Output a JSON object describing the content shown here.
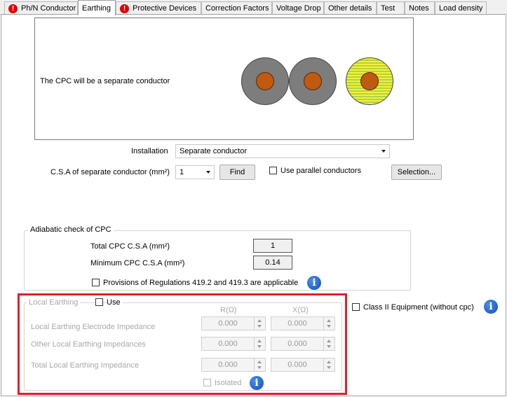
{
  "tabs": [
    {
      "label": "Ph/N Conductor",
      "warning": true
    },
    {
      "label": "Earthing",
      "active": true
    },
    {
      "label": "Protective Devices",
      "warning": true
    },
    {
      "label": "Correction Factors"
    },
    {
      "label": "Voltage Drop"
    },
    {
      "label": "Other details"
    },
    {
      "label": "Test"
    },
    {
      "label": "Notes"
    },
    {
      "label": "Load density"
    }
  ],
  "preview": {
    "text": "The CPC will be a separate conductor"
  },
  "installation": {
    "label": "Installation",
    "value": "Separate conductor"
  },
  "csa": {
    "label": "C.S.A of separate conductor (mm²)",
    "value": "1",
    "find_label": "Find",
    "parallel_label": "Use parallel conductors",
    "selection_label": "Selection..."
  },
  "adiabatic": {
    "title": "Adiabatic check of CPC",
    "total_label": "Total CPC C.S.A (mm²)",
    "total_value": "1",
    "min_label": "Minimum CPC C.S.A (mm²)",
    "min_value": "0.14",
    "provisions_label": "Provisions of Regulations 419.2 and 419.3 are applicable"
  },
  "class2": {
    "label": "Class II Equipment (without cpc)"
  },
  "local_earthing": {
    "title": "Local Earthing",
    "use_label": "Use",
    "col_r": "R(Ω)",
    "col_x": "X(Ω)",
    "rows": [
      {
        "label": "Local Earthing Electrode Impedance",
        "r": "0.000",
        "x": "0.000"
      },
      {
        "label": "Other Local Earthing Impedances",
        "r": "0.000",
        "x": "0.000"
      },
      {
        "label": "Total Local Earthing Impedance",
        "r": "0.000",
        "x": "0.000"
      }
    ],
    "isolated_label": "Isolated"
  },
  "icons": {
    "info": "i",
    "warning": "!"
  },
  "colors": {
    "highlight": "#e0202a",
    "warning": "#e00000",
    "core": "#c05a10"
  }
}
